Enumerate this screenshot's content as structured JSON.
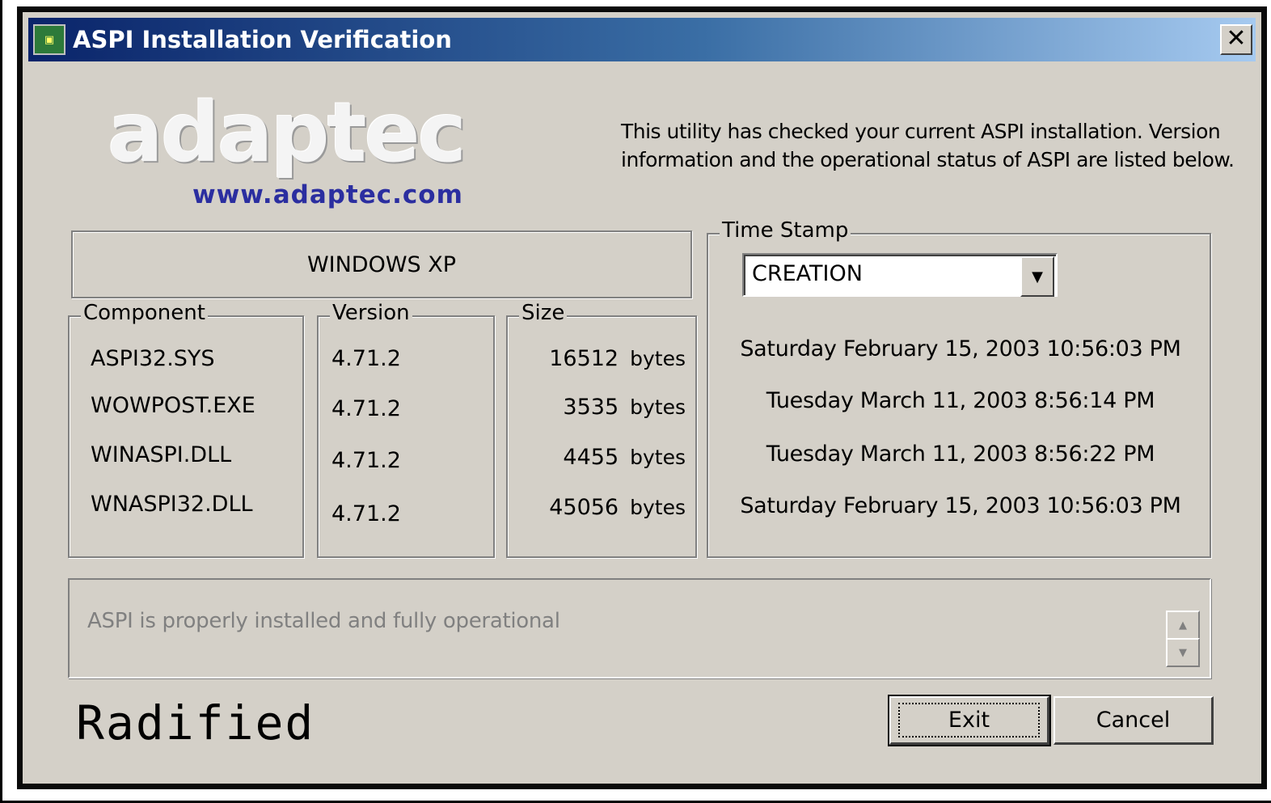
{
  "window": {
    "title": "ASPI Installation Verification",
    "close_label": "✕"
  },
  "logo": {
    "brand": "adaptec",
    "url": "www.adaptec.com"
  },
  "intro_text": "This utility has checked your current ASPI installation. Version information and the operational status of ASPI are listed below.",
  "os_label": "WINDOWS XP",
  "groups": {
    "component": "Component",
    "version": "Version",
    "size": "Size",
    "timestamp": "Time Stamp"
  },
  "rows": [
    {
      "component": "ASPI32.SYS",
      "version": "4.71.2",
      "size": "16512",
      "unit": "bytes",
      "timestamp": "Saturday February 15, 2003 10:56:03 PM"
    },
    {
      "component": "WOWPOST.EXE",
      "version": "4.71.2",
      "size": "3535",
      "unit": "bytes",
      "timestamp": "Tuesday March 11, 2003 8:56:14 PM"
    },
    {
      "component": "WINASPI.DLL",
      "version": "4.71.2",
      "size": "4455",
      "unit": "bytes",
      "timestamp": "Tuesday March 11, 2003 8:56:22 PM"
    },
    {
      "component": "WNASPI32.DLL",
      "version": "4.71.2",
      "size": "45056",
      "unit": "bytes",
      "timestamp": "Saturday February 15, 2003 10:56:03 PM"
    }
  ],
  "timestamp_select": {
    "value": "CREATION"
  },
  "status_text": "ASPI is properly installed and fully operational",
  "watermark": "Radified",
  "buttons": {
    "exit": "Exit",
    "cancel": "Cancel"
  },
  "icons": {
    "app": "app-icon",
    "close": "close-icon",
    "dropdown": "chevron-down-icon",
    "spin_up": "arrow-up-icon",
    "spin_down": "arrow-down-icon"
  },
  "colors": {
    "titlebar_start": "#0a246a",
    "titlebar_end": "#a6caf0",
    "face": "#d4d0c8",
    "url_blue": "#2b2ea0",
    "status_gray": "#808080"
  }
}
